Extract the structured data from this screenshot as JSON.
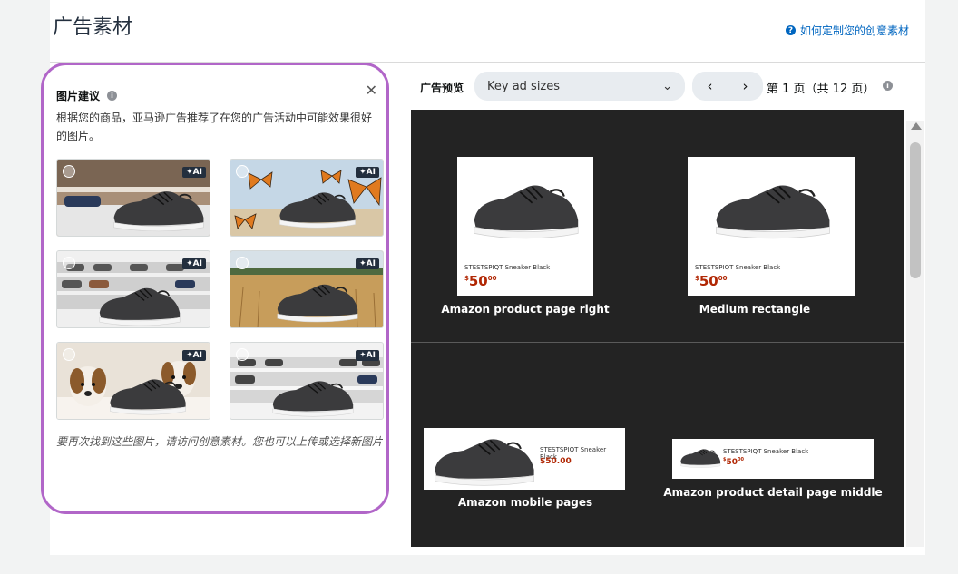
{
  "header": {
    "title": "广告素材",
    "help_link": "如何定制您的创意素材"
  },
  "suggestions": {
    "title": "图片建议",
    "description": "根据您的商品，亚马逊广告推荐了在您的广告活动中可能效果很好的图片。",
    "ai_badge": "✦AI",
    "footer": "要再次找到这些图片，请访问创意素材。您也可以上传或选择新图片",
    "thumbnails": [
      "shoe-store-shelf",
      "butterflies",
      "shoe-rack",
      "wheat-field",
      "dogs",
      "store-display"
    ]
  },
  "preview": {
    "label": "广告预览",
    "size_select": "Key ad sizes",
    "page_info": "第 1 页（共 12 页）",
    "ads": [
      {
        "name": "Amazon product page right",
        "product": "STESTSPIQT Sneaker Black",
        "price_whole": "50",
        "price_frac": "00"
      },
      {
        "name": "Medium rectangle",
        "product": "STESTSPIQT Sneaker Black",
        "price_whole": "50",
        "price_frac": "00"
      },
      {
        "name": "Amazon mobile pages",
        "product": "STESTSPIQT Sneaker Black",
        "price": "$50.00"
      },
      {
        "name": "Amazon product detail page middle",
        "product": "STESTSPIQT Sneaker Black",
        "price_whole": "50",
        "price_frac": "00"
      }
    ]
  },
  "colors": {
    "accent": "#b166c8",
    "link": "#0066c0",
    "preview_bg": "#232323",
    "price": "#b12704"
  }
}
